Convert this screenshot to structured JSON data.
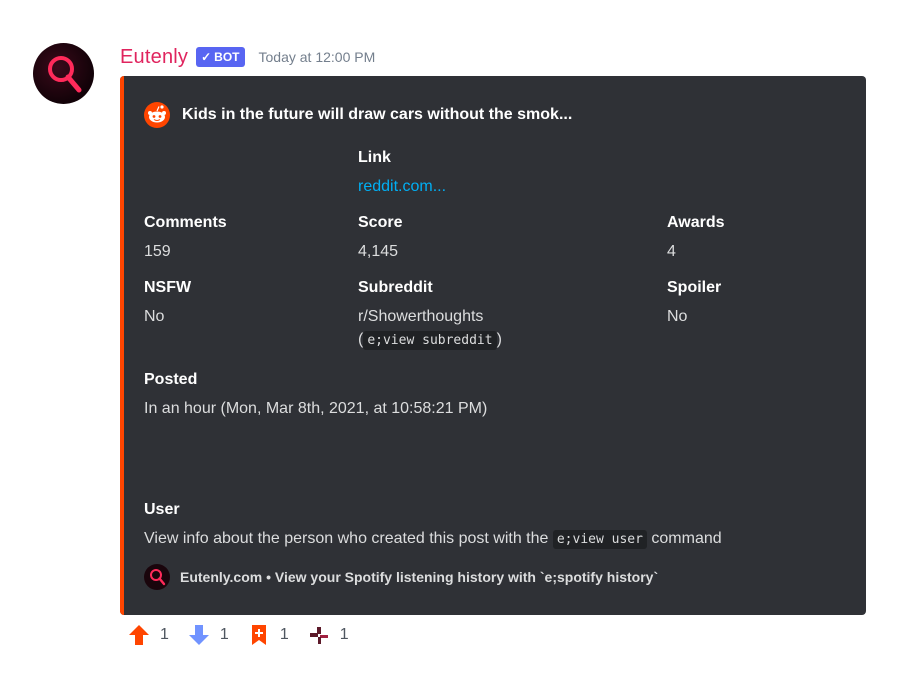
{
  "message": {
    "username": "Eutenly",
    "bot_tag": "BOT",
    "timestamp": "Today at 12:00 PM"
  },
  "embed": {
    "accent_color": "#ff4500",
    "title": "Kids in the future will draw cars without the smok...",
    "fields": {
      "link": {
        "name": "Link",
        "value": "reddit.com..."
      },
      "comments": {
        "name": "Comments",
        "value": "159"
      },
      "score": {
        "name": "Score",
        "value": "4,145"
      },
      "awards": {
        "name": "Awards",
        "value": "4"
      },
      "nsfw": {
        "name": "NSFW",
        "value": "No"
      },
      "subreddit": {
        "name": "Subreddit",
        "value": "r/Showerthoughts",
        "command": "e;view subreddit"
      },
      "spoiler": {
        "name": "Spoiler",
        "value": "No"
      },
      "posted": {
        "name": "Posted",
        "value": "In an hour (Mon, Mar 8th, 2021, at 10:58:21 PM)"
      },
      "user": {
        "name": "User",
        "value_prefix": "View info about the person who created this post with the",
        "command": "e;view user",
        "value_suffix": "command"
      }
    },
    "footer": "Eutenly.com • View your Spotify listening history with `e;spotify history`"
  },
  "reactions": [
    {
      "icon": "upvote-icon",
      "count": "1"
    },
    {
      "icon": "downvote-icon",
      "count": "1"
    },
    {
      "icon": "bookmark-add-icon",
      "count": "1"
    },
    {
      "icon": "pixel-art-icon",
      "count": "1"
    }
  ]
}
